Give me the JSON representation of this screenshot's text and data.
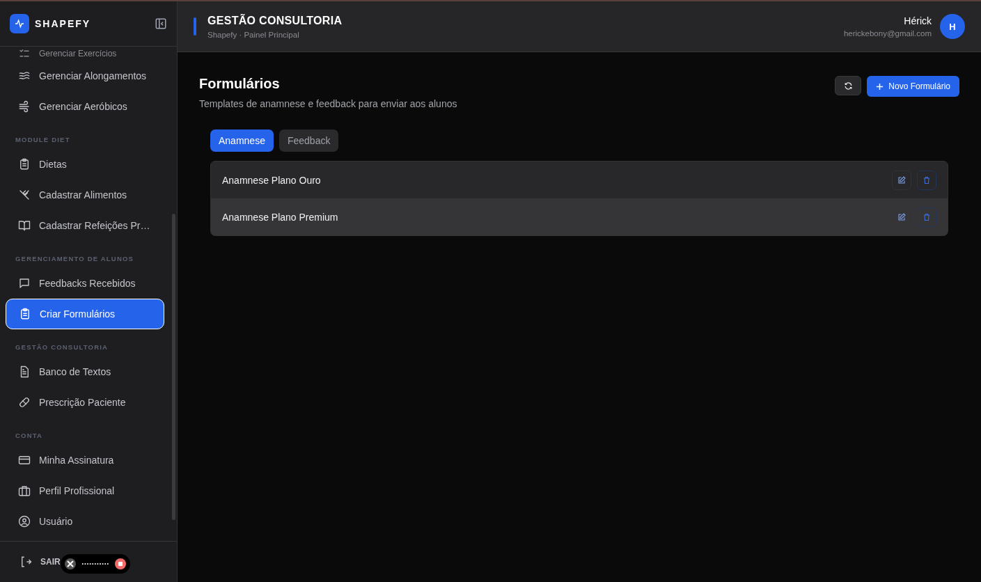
{
  "sidebar": {
    "brand": "SHAPEFY",
    "sections": [
      {
        "items": [
          {
            "label": "Gerenciar Exercícios",
            "selected": false
          },
          {
            "label": "Gerenciar Alongamentos",
            "selected": false
          },
          {
            "label": "Gerenciar Aeróbicos",
            "selected": false
          }
        ]
      },
      {
        "title": "MODULE DIET",
        "items": [
          {
            "label": "Dietas",
            "selected": false
          },
          {
            "label": "Cadastrar Alimentos",
            "selected": false
          },
          {
            "label": "Cadastrar Refeições Pr…",
            "selected": false
          }
        ]
      },
      {
        "title": "GERENCIAMENTO DE ALUNOS",
        "items": [
          {
            "label": "Feedbacks Recebidos",
            "selected": false
          },
          {
            "label": "Criar Formulários",
            "selected": true
          }
        ]
      },
      {
        "title": "GESTÃO CONSULTORIA",
        "items": [
          {
            "label": "Banco de Textos",
            "selected": false
          },
          {
            "label": "Prescrição Paciente",
            "selected": false
          }
        ]
      },
      {
        "title": "CONTA",
        "items": [
          {
            "label": "Minha Assinatura",
            "selected": false
          },
          {
            "label": "Perfil Profissional",
            "selected": false
          },
          {
            "label": "Usuário",
            "selected": false
          }
        ]
      }
    ],
    "logout": "SAIR"
  },
  "header": {
    "title": "GESTÃO CONSULTORIA",
    "subtitle": "Shapefy · Painel Principal",
    "user_name": "Hérick",
    "user_email": "herickebony@gmail.com",
    "avatar": "H"
  },
  "page": {
    "title": "Formulários",
    "subtitle": "Templates de anamnese e feedback para enviar aos alunos",
    "new_button": "Novo Formulário",
    "tabs": [
      {
        "label": "Anamnese",
        "selected": true
      },
      {
        "label": "Feedback",
        "selected": false
      }
    ],
    "rows": [
      {
        "name": "Anamnese Plano Ouro",
        "selected": false
      },
      {
        "name": "Anamnese Plano Premium",
        "selected": true
      }
    ]
  }
}
